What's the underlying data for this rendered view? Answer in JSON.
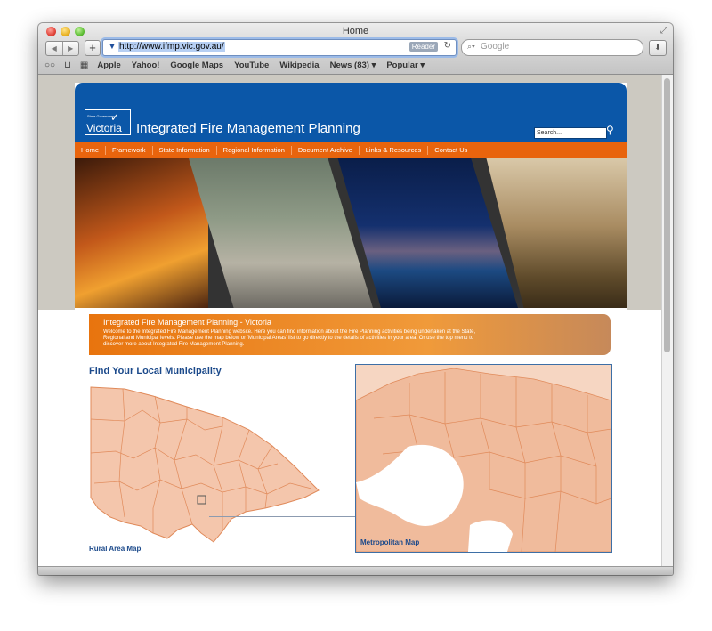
{
  "browser": {
    "window_title": "Home",
    "url": "http://www.ifmp.vic.gov.au/",
    "reader_label": "Reader",
    "search_placeholder": "Google",
    "bookmarks": [
      "Apple",
      "Yahoo!",
      "Google Maps",
      "YouTube",
      "Wikipedia",
      "News (83) ▾",
      "Popular ▾"
    ]
  },
  "site": {
    "logo_text": "Victoria",
    "logo_small_text": "State Government",
    "title": "Integrated Fire Management Planning",
    "search_placeholder": "Search...",
    "nav": [
      "Home",
      "Framework",
      "State Information",
      "Regional Information",
      "Document Archive",
      "Links & Resources",
      "Contact Us"
    ],
    "intro_title": "Integrated Fire Management Planning - Victoria",
    "intro_text": "Welcome to the Integrated Fire Management Planning website. Here you can find information about the Fire Planning activities being undertaken at the State, Regional and Municipal levels. Please use the map below or 'Municipal Areas' list to go directly to the details of activities in your area. Or use the top menu to discover more about Integrated Fire Management Planning.",
    "find_title": "Find Your Local Municipality",
    "rural_map_label": "Rural Area Map",
    "metro_map_label": "Metropolitan Map"
  },
  "colors": {
    "header_blue": "#0b57a8",
    "nav_orange": "#e8640d",
    "map_fill": "#f4c6ac",
    "map_line": "#e08a5a",
    "heading_blue": "#1c4a8b"
  }
}
